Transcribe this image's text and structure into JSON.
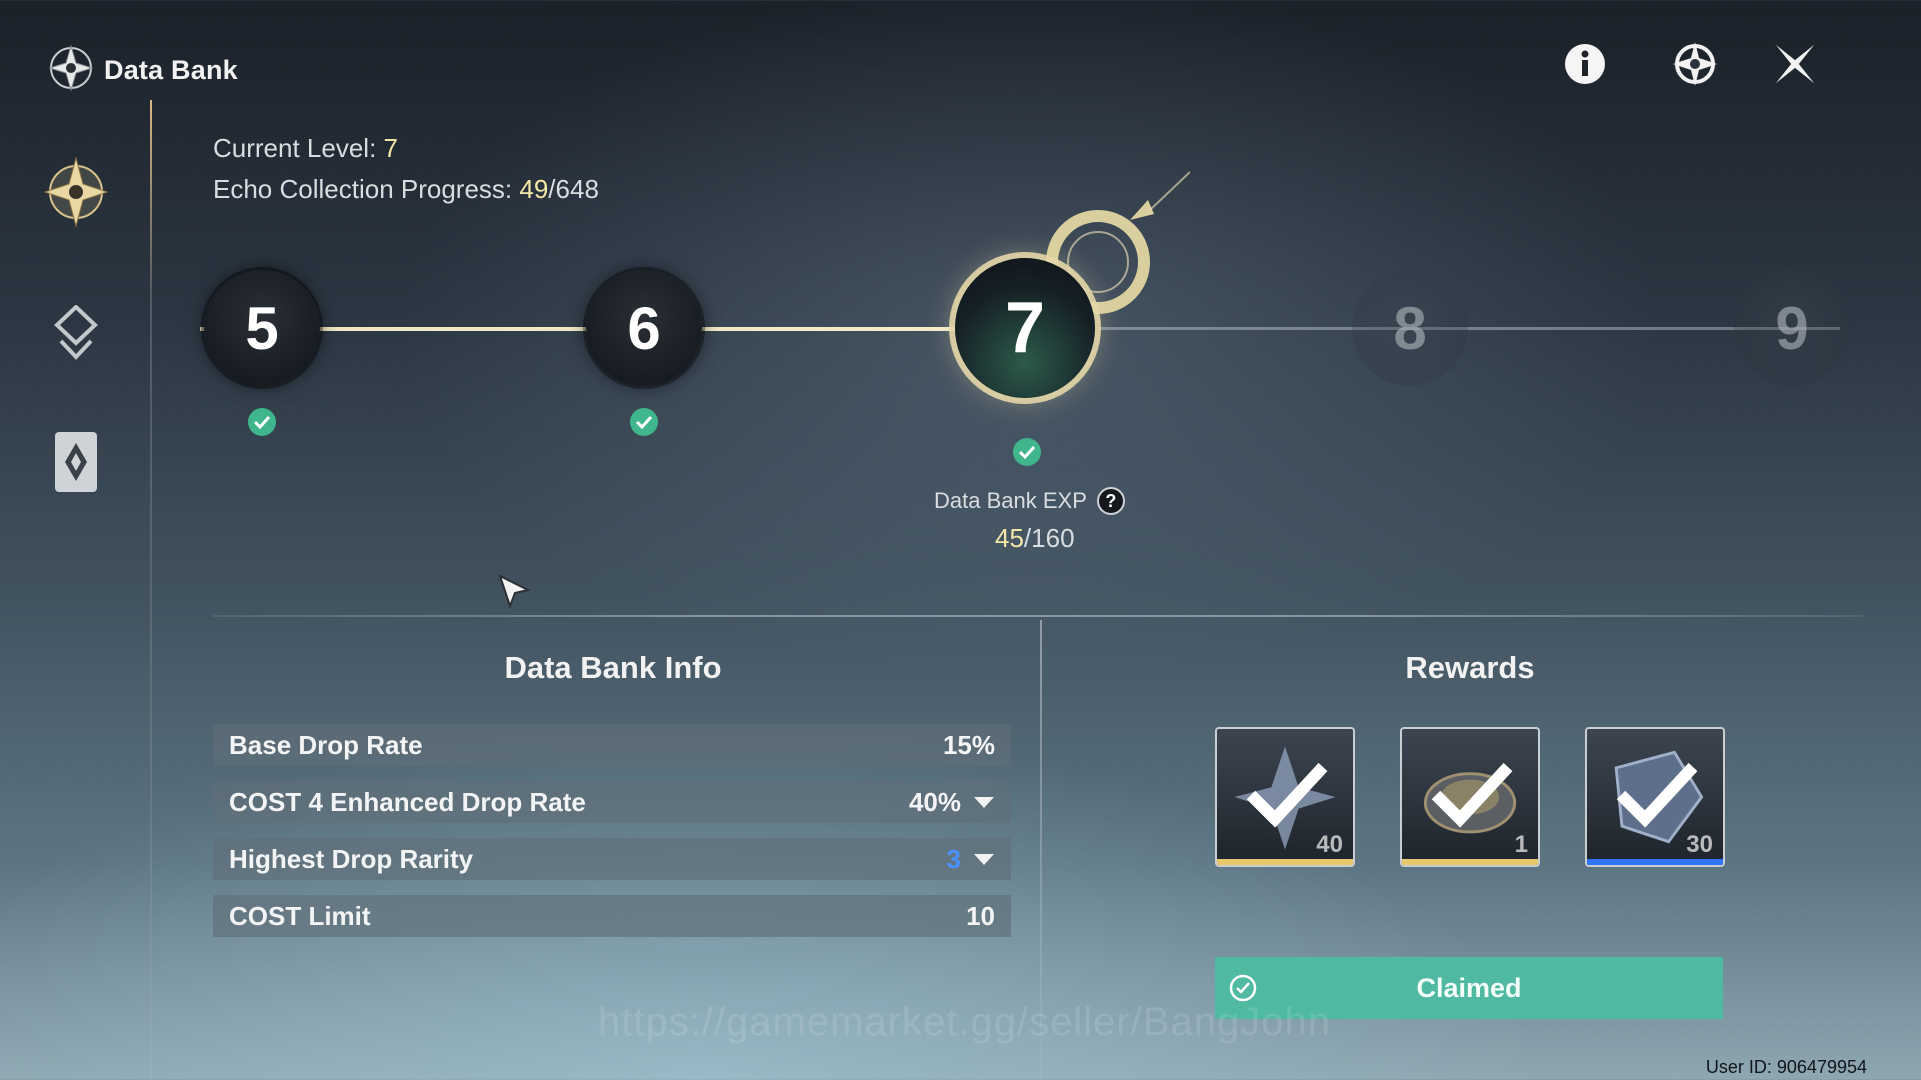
{
  "header": {
    "title": "Data Bank",
    "logo_icon": "data-bank-emblem-icon"
  },
  "top_icons": [
    {
      "name": "info-icon"
    },
    {
      "name": "tuner-icon"
    },
    {
      "name": "close-icon"
    }
  ],
  "side_nav": [
    {
      "name": "data-bank-emblem-icon",
      "active": true
    },
    {
      "name": "echo-list-icon",
      "active": false
    },
    {
      "name": "card-icon",
      "active": false
    }
  ],
  "level_info": {
    "current_level_label": "Current Level:",
    "current_level_value": "7",
    "progress_label": "Echo Collection Progress:",
    "progress_current": "49",
    "progress_total": "/648"
  },
  "levels": [
    {
      "number": "5",
      "state": "done"
    },
    {
      "number": "6",
      "state": "done"
    },
    {
      "number": "7",
      "state": "current"
    },
    {
      "number": "8",
      "state": "locked"
    },
    {
      "number": "9",
      "state": "locked"
    }
  ],
  "exp": {
    "label": "Data Bank EXP",
    "help": "?",
    "current": "45",
    "total": "/160"
  },
  "info_panel": {
    "title": "Data Bank Info",
    "rows": [
      {
        "label": "Base Drop Rate",
        "value": "15%",
        "arrow": false
      },
      {
        "label": "COST 4 Enhanced Drop Rate",
        "value": "40%",
        "arrow": true
      },
      {
        "label": "Highest Drop Rarity",
        "value": "3",
        "arrow": true
      },
      {
        "label": "COST Limit",
        "value": "10",
        "arrow": false
      }
    ]
  },
  "rewards": {
    "title": "Rewards",
    "items": [
      {
        "quantity": "40",
        "icon": "star-shard-icon",
        "rarity_color": "#e8c86a"
      },
      {
        "quantity": "1",
        "icon": "shell-credit-icon",
        "rarity_color": "#e8c86a"
      },
      {
        "quantity": "30",
        "icon": "tuner-crystal-icon",
        "rarity_color": "#2f74ff"
      }
    ],
    "claimed_label": "Claimed"
  },
  "watermark": "https://gamemarket.gg/seller/BangJohn",
  "user_id": "User ID: 906479954",
  "colors": {
    "accent_gold": "#f3e6a6",
    "claimed_green": "#4fb9a1",
    "check_green": "#3fb68c",
    "rarity_blue": "#4a90ff"
  }
}
